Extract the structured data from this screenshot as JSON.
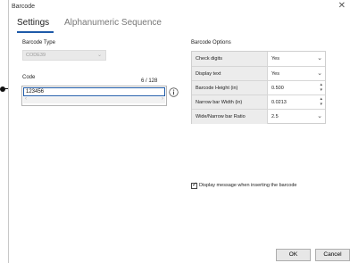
{
  "window": {
    "title": "Barcode",
    "close_glyph": "✕"
  },
  "tabs": [
    {
      "label": "Settings",
      "active": true
    },
    {
      "label": "Alphanumeric Sequence",
      "active": false
    }
  ],
  "barcode_type": {
    "label": "Barcode Type",
    "value": "CODE39"
  },
  "code": {
    "label": "Code",
    "counter": "6 / 128",
    "value": "123456"
  },
  "options": {
    "heading": "Barcode Options",
    "rows": [
      {
        "label": "Check digits",
        "value": "Yes",
        "control": "dropdown"
      },
      {
        "label": "Display text",
        "value": "Yes",
        "control": "dropdown"
      },
      {
        "label": "Barcode Height (in)",
        "value": "0.500",
        "control": "spinner"
      },
      {
        "label": "Narrow bar Width (in)",
        "value": "0.0213",
        "control": "spinner"
      },
      {
        "label": "Wide/Narrow bar Ratio",
        "value": "2.5",
        "control": "dropdown"
      }
    ]
  },
  "display_message": {
    "label": "Display message when inserting the barcode",
    "checked": true
  },
  "buttons": {
    "ok": "OK",
    "cancel": "Cancel"
  },
  "icons": {
    "info": "info-icon",
    "close": "close-icon",
    "chevron": "chevron-down-icon"
  },
  "colors": {
    "accent": "#1e5aa8",
    "label_bg": "#ececec",
    "button_bg": "#e7e7e7"
  }
}
